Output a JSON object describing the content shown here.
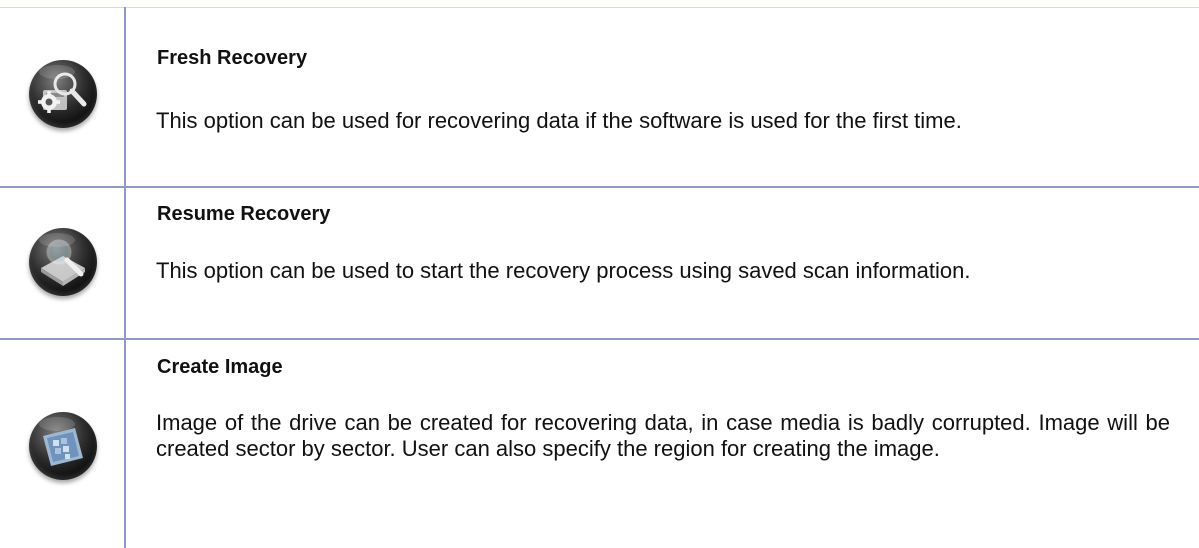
{
  "options": [
    {
      "icon": "fresh-recovery-icon",
      "title": "Fresh Recovery",
      "description": "This option can be used for recovering data if the software is used for the first time."
    },
    {
      "icon": "resume-recovery-icon",
      "title": "Resume Recovery",
      "description": "This option can be used to start the recovery process using saved scan information."
    },
    {
      "icon": "create-image-icon",
      "title": "Create Image",
      "description": "Image of the drive can be created for recovering data, in case media is badly corrupted. Image will be created sector by sector. User can also specify the region for creating the image."
    }
  ],
  "colors": {
    "border": "#9098c8",
    "text": "#111111"
  }
}
